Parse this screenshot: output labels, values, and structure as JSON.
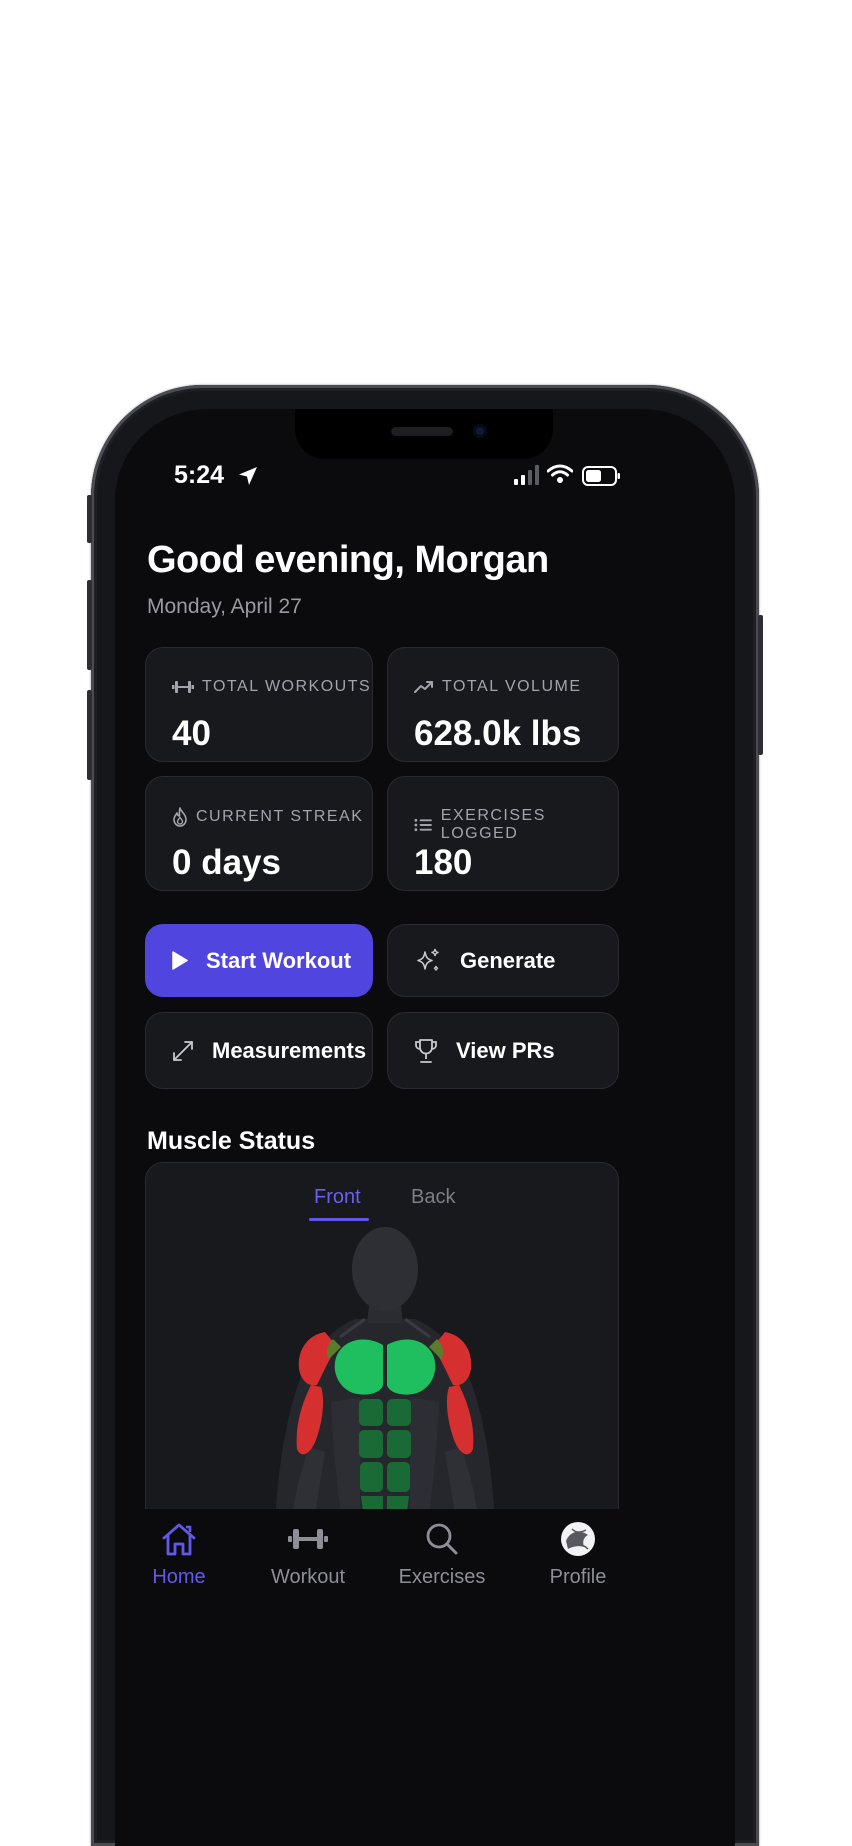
{
  "status": {
    "time": "5:24"
  },
  "header": {
    "greeting": "Good evening, Morgan",
    "date": "Monday, April 27"
  },
  "stats": [
    {
      "label": "TOTAL WORKOUTS",
      "value": "40",
      "icon": "dumbbell-icon"
    },
    {
      "label": "TOTAL VOLUME",
      "value": "628.0k lbs",
      "icon": "trending-up-icon"
    },
    {
      "label": "CURRENT STREAK",
      "value": "0 days",
      "icon": "flame-icon"
    },
    {
      "label": "EXERCISES LOGGED",
      "value": "180",
      "icon": "list-icon"
    }
  ],
  "actions": {
    "start_workout": "Start Workout",
    "generate": "Generate",
    "measurements": "Measurements",
    "view_prs": "View PRs"
  },
  "muscle_status": {
    "title": "Muscle Status",
    "tabs": [
      "Front",
      "Back"
    ],
    "selected_tab": "Front",
    "colors": {
      "recovered": "#1fbf5f",
      "fatigued": "#d62f2f",
      "partial": "#5b7d2b"
    }
  },
  "tabbar": {
    "items": [
      {
        "label": "Home",
        "icon": "home-icon",
        "active": true
      },
      {
        "label": "Workout",
        "icon": "dumbbell-icon",
        "active": false
      },
      {
        "label": "Exercises",
        "icon": "search-icon",
        "active": false
      },
      {
        "label": "Profile",
        "icon": "avatar-icon",
        "active": false
      }
    ]
  },
  "theme": {
    "accent": "#5145e0",
    "background": "#0b0b0e",
    "card": "#18191d"
  }
}
